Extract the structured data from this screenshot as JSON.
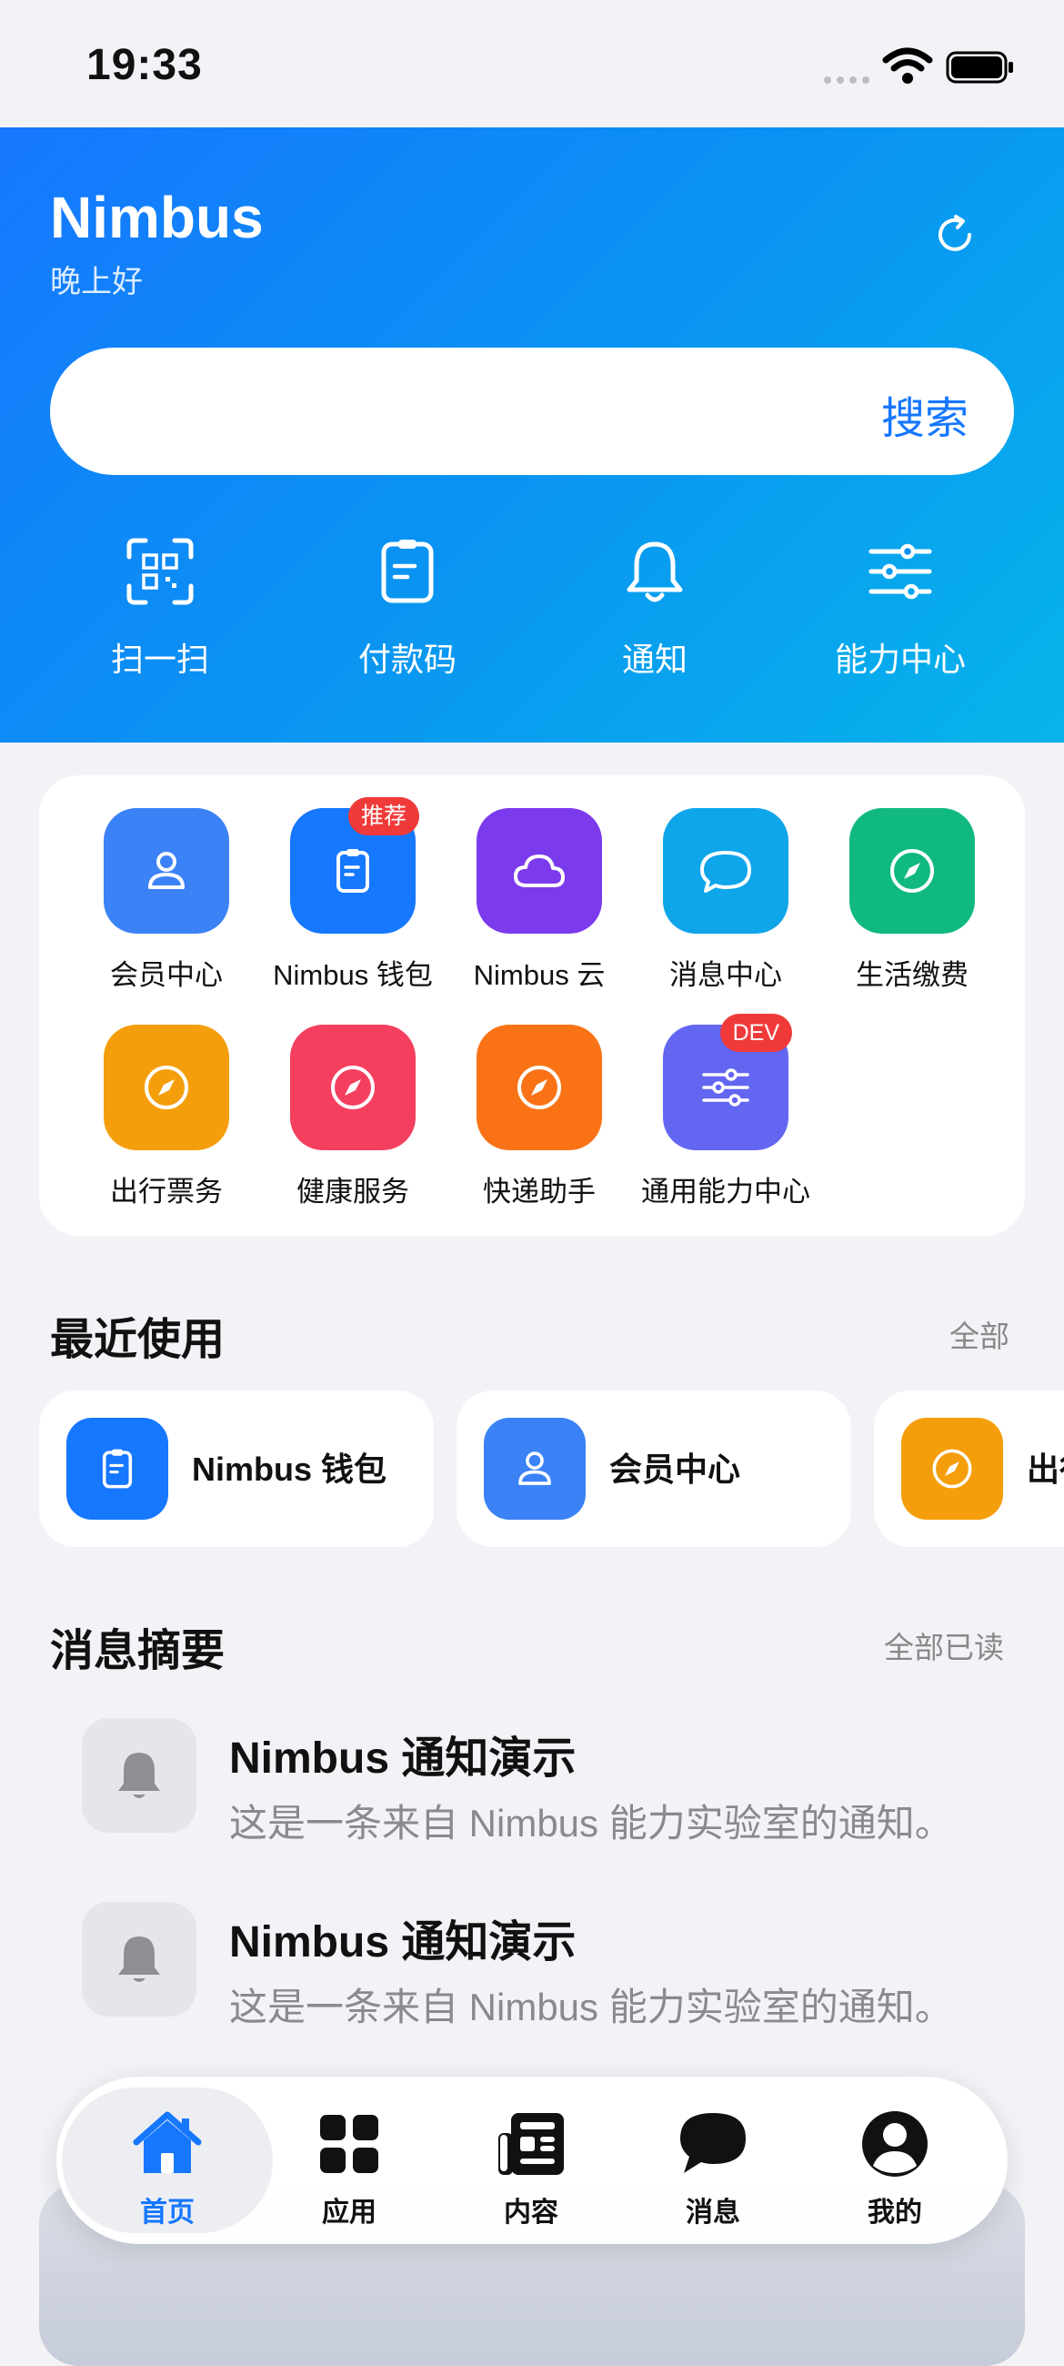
{
  "status": {
    "time": "19:33"
  },
  "header": {
    "title": "Nimbus",
    "greeting": "晚上好"
  },
  "search": {
    "placeholder": "",
    "button": "搜索"
  },
  "quick_actions": [
    {
      "label": "扫一扫",
      "icon": "scan-icon"
    },
    {
      "label": "付款码",
      "icon": "payment-code-icon"
    },
    {
      "label": "通知",
      "icon": "bell-icon"
    },
    {
      "label": "能力中心",
      "icon": "sliders-icon"
    }
  ],
  "apps": [
    {
      "label": "会员中心",
      "icon": "person-icon",
      "color": "#3b82f6"
    },
    {
      "label": "Nimbus 钱包",
      "icon": "wallet-icon",
      "color": "#1677ff",
      "badge": "推荐"
    },
    {
      "label": "Nimbus 云",
      "icon": "cloud-icon",
      "color": "#7c3aed"
    },
    {
      "label": "消息中心",
      "icon": "chat-icon",
      "color": "#0ea5e9"
    },
    {
      "label": "生活缴费",
      "icon": "compass-icon",
      "color": "#10b981"
    },
    {
      "label": "出行票务",
      "icon": "compass-icon",
      "color": "#f59e0b"
    },
    {
      "label": "健康服务",
      "icon": "compass-icon",
      "color": "#f43f5e"
    },
    {
      "label": "快递助手",
      "icon": "compass-icon",
      "color": "#f97316"
    },
    {
      "label": "通用能力中心",
      "icon": "sliders-icon",
      "color": "#6366f1",
      "badge": "DEV"
    }
  ],
  "recent": {
    "title": "最近使用",
    "link": "全部",
    "items": [
      {
        "label": "Nimbus 钱包",
        "icon": "wallet-icon",
        "color": "#1677ff"
      },
      {
        "label": "会员中心",
        "icon": "person-icon",
        "color": "#3b82f6"
      },
      {
        "label": "出行票务",
        "icon": "compass-icon",
        "color": "#f59e0b"
      }
    ]
  },
  "messages": {
    "title": "消息摘要",
    "link": "全部已读",
    "items": [
      {
        "title": "Nimbus 通知演示",
        "body": "这是一条来自 Nimbus 能力实验室的通知。"
      },
      {
        "title": "Nimbus 通知演示",
        "body": "这是一条来自 Nimbus 能力实验室的通知。"
      }
    ]
  },
  "tabs": [
    {
      "label": "首页",
      "icon": "home-icon",
      "active": true
    },
    {
      "label": "应用",
      "icon": "grid-icon"
    },
    {
      "label": "内容",
      "icon": "newspaper-icon"
    },
    {
      "label": "消息",
      "icon": "chat-bubble-icon"
    },
    {
      "label": "我的",
      "icon": "profile-icon"
    }
  ]
}
